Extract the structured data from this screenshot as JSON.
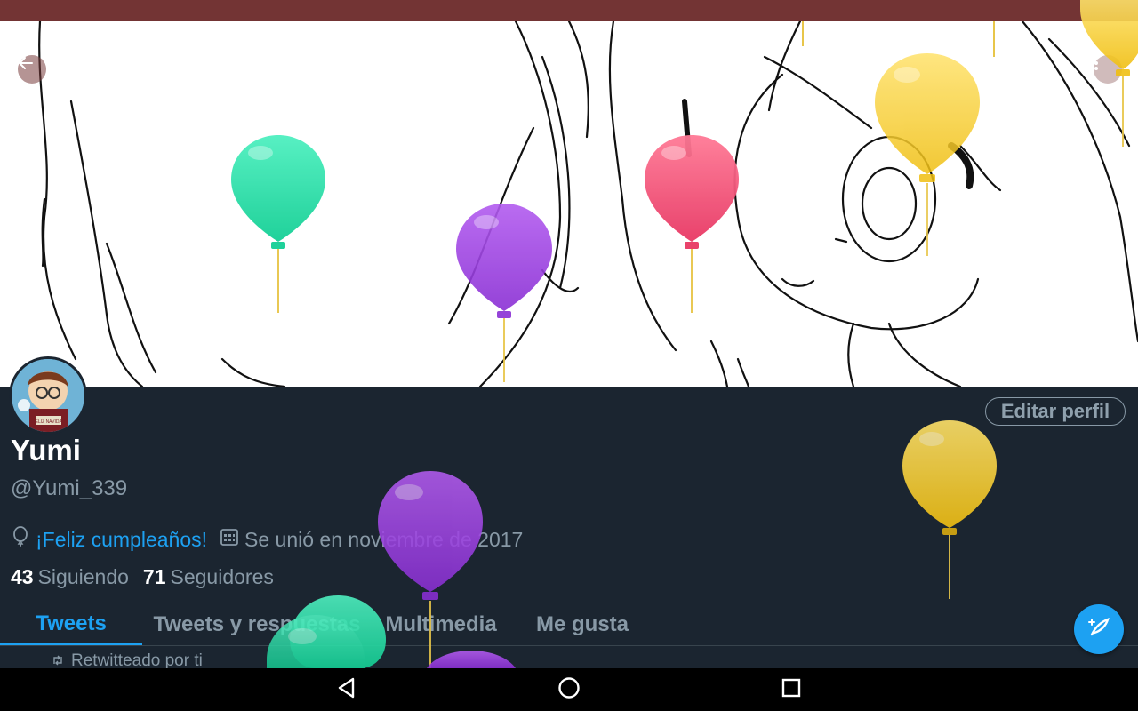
{
  "profile": {
    "name": "Yumi",
    "handle": "@Yumi_339",
    "birthday_text": "¡Feliz cumpleaños!",
    "joined_text": "Se unió en noviembre de 2017",
    "following_count": "43",
    "following_label": "Siguiendo",
    "followers_count": "71",
    "followers_label": "Seguidores",
    "edit_label": "Editar perfil",
    "avatar_caption": "FELIZ NAVIDAD"
  },
  "tabs": [
    {
      "label": "Tweets",
      "active": true
    },
    {
      "label": "Tweets y respuestas",
      "active": false
    },
    {
      "label": "Multimedia",
      "active": false
    },
    {
      "label": "Me gusta",
      "active": false
    }
  ],
  "timeline": {
    "retweet_label": "Retwitteado por ti"
  },
  "icons": {
    "back": "arrow-left-icon",
    "more": "more-options-icon",
    "birthday": "balloon-icon",
    "calendar": "calendar-icon",
    "retweet": "retweet-icon",
    "compose": "compose-tweet-icon",
    "nav_back": "nav-back-icon",
    "nav_home": "nav-home-icon",
    "nav_recents": "nav-recents-icon"
  },
  "colors": {
    "accent": "#1da1f2",
    "status_bar": "#733434",
    "background": "#1b2530",
    "balloon_teal": "#2fe0a8",
    "balloon_purple": "#9a3fe0",
    "balloon_pink": "#f2557a",
    "balloon_yellow": "#f3cf38"
  }
}
